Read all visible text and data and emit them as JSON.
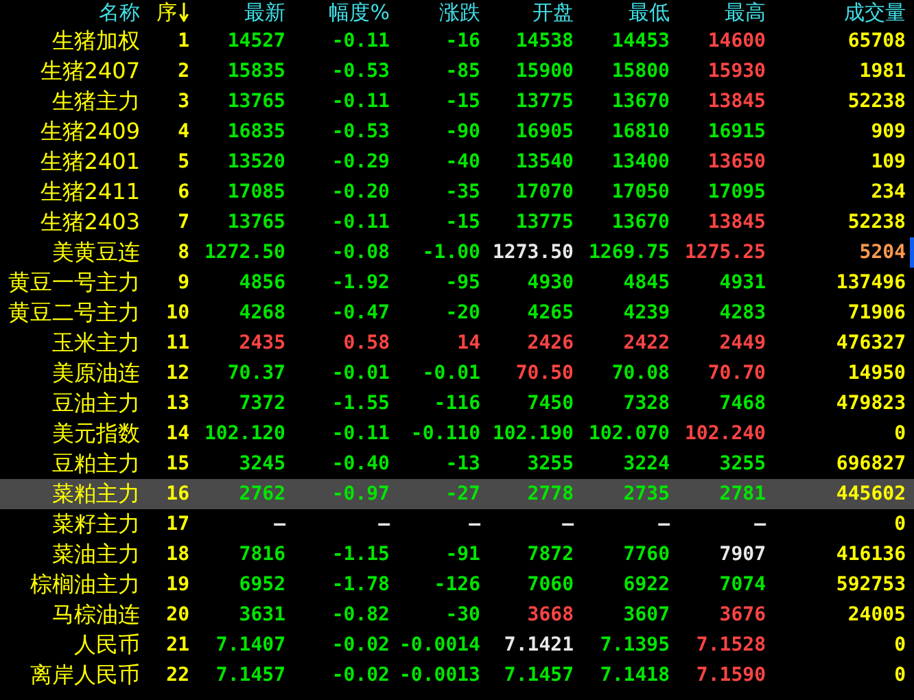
{
  "table": {
    "columns": [
      {
        "label": "名称",
        "sorted": false
      },
      {
        "label": "序",
        "sorted": true
      },
      {
        "label": "最新",
        "sorted": false
      },
      {
        "label": "幅度%",
        "sorted": false
      },
      {
        "label": "涨跌",
        "sorted": false
      },
      {
        "label": "开盘",
        "sorted": false
      },
      {
        "label": "最低",
        "sorted": false
      },
      {
        "label": "最高",
        "sorted": false
      },
      {
        "label": "成交量",
        "sorted": false
      }
    ],
    "rows": [
      {
        "selected": false,
        "marker": false,
        "cells": [
          {
            "text": "生猪加权",
            "color": "#ffff00"
          },
          {
            "text": "1",
            "color": "#ffff00"
          },
          {
            "text": "14527",
            "color": "#00e600"
          },
          {
            "text": "-0.11",
            "color": "#00e600"
          },
          {
            "text": "-16",
            "color": "#00e600"
          },
          {
            "text": "14538",
            "color": "#00e600"
          },
          {
            "text": "14453",
            "color": "#00e600"
          },
          {
            "text": "14600",
            "color": "#ff4444"
          },
          {
            "text": "65708",
            "color": "#ffff00"
          }
        ]
      },
      {
        "selected": false,
        "marker": false,
        "cells": [
          {
            "text": "生猪2407",
            "color": "#ffff00"
          },
          {
            "text": "2",
            "color": "#ffff00"
          },
          {
            "text": "15835",
            "color": "#00e600"
          },
          {
            "text": "-0.53",
            "color": "#00e600"
          },
          {
            "text": "-85",
            "color": "#00e600"
          },
          {
            "text": "15900",
            "color": "#00e600"
          },
          {
            "text": "15800",
            "color": "#00e600"
          },
          {
            "text": "15930",
            "color": "#ff4444"
          },
          {
            "text": "1981",
            "color": "#ffff00"
          }
        ]
      },
      {
        "selected": false,
        "marker": false,
        "cells": [
          {
            "text": "生猪主力",
            "color": "#ffff00"
          },
          {
            "text": "3",
            "color": "#ffff00"
          },
          {
            "text": "13765",
            "color": "#00e600"
          },
          {
            "text": "-0.11",
            "color": "#00e600"
          },
          {
            "text": "-15",
            "color": "#00e600"
          },
          {
            "text": "13775",
            "color": "#00e600"
          },
          {
            "text": "13670",
            "color": "#00e600"
          },
          {
            "text": "13845",
            "color": "#ff4444"
          },
          {
            "text": "52238",
            "color": "#ffff00"
          }
        ]
      },
      {
        "selected": false,
        "marker": false,
        "cells": [
          {
            "text": "生猪2409",
            "color": "#ffff00"
          },
          {
            "text": "4",
            "color": "#ffff00"
          },
          {
            "text": "16835",
            "color": "#00e600"
          },
          {
            "text": "-0.53",
            "color": "#00e600"
          },
          {
            "text": "-90",
            "color": "#00e600"
          },
          {
            "text": "16905",
            "color": "#00e600"
          },
          {
            "text": "16810",
            "color": "#00e600"
          },
          {
            "text": "16915",
            "color": "#00e600"
          },
          {
            "text": "909",
            "color": "#ffff00"
          }
        ]
      },
      {
        "selected": false,
        "marker": false,
        "cells": [
          {
            "text": "生猪2401",
            "color": "#ffff00"
          },
          {
            "text": "5",
            "color": "#ffff00"
          },
          {
            "text": "13520",
            "color": "#00e600"
          },
          {
            "text": "-0.29",
            "color": "#00e600"
          },
          {
            "text": "-40",
            "color": "#00e600"
          },
          {
            "text": "13540",
            "color": "#00e600"
          },
          {
            "text": "13400",
            "color": "#00e600"
          },
          {
            "text": "13650",
            "color": "#ff4444"
          },
          {
            "text": "109",
            "color": "#ffff00"
          }
        ]
      },
      {
        "selected": false,
        "marker": false,
        "cells": [
          {
            "text": "生猪2411",
            "color": "#ffff00"
          },
          {
            "text": "6",
            "color": "#ffff00"
          },
          {
            "text": "17085",
            "color": "#00e600"
          },
          {
            "text": "-0.20",
            "color": "#00e600"
          },
          {
            "text": "-35",
            "color": "#00e600"
          },
          {
            "text": "17070",
            "color": "#00e600"
          },
          {
            "text": "17050",
            "color": "#00e600"
          },
          {
            "text": "17095",
            "color": "#00e600"
          },
          {
            "text": "234",
            "color": "#ffff00"
          }
        ]
      },
      {
        "selected": false,
        "marker": false,
        "cells": [
          {
            "text": "生猪2403",
            "color": "#ffff00"
          },
          {
            "text": "7",
            "color": "#ffff00"
          },
          {
            "text": "13765",
            "color": "#00e600"
          },
          {
            "text": "-0.11",
            "color": "#00e600"
          },
          {
            "text": "-15",
            "color": "#00e600"
          },
          {
            "text": "13775",
            "color": "#00e600"
          },
          {
            "text": "13670",
            "color": "#00e600"
          },
          {
            "text": "13845",
            "color": "#ff4444"
          },
          {
            "text": "52238",
            "color": "#ffff00"
          }
        ]
      },
      {
        "selected": false,
        "marker": true,
        "cells": [
          {
            "text": "美黄豆连",
            "color": "#ffff00"
          },
          {
            "text": "8",
            "color": "#ffff00"
          },
          {
            "text": "1272.50",
            "color": "#00e600"
          },
          {
            "text": "-0.08",
            "color": "#00e600"
          },
          {
            "text": "-1.00",
            "color": "#00e600"
          },
          {
            "text": "1273.50",
            "color": "#e8e8e8"
          },
          {
            "text": "1269.75",
            "color": "#00e600"
          },
          {
            "text": "1275.25",
            "color": "#ff4444"
          },
          {
            "text": "5204",
            "color": "#ff9a50"
          }
        ]
      },
      {
        "selected": false,
        "marker": false,
        "cells": [
          {
            "text": "黄豆一号主力",
            "color": "#ffff00"
          },
          {
            "text": "9",
            "color": "#ffff00"
          },
          {
            "text": "4856",
            "color": "#00e600"
          },
          {
            "text": "-1.92",
            "color": "#00e600"
          },
          {
            "text": "-95",
            "color": "#00e600"
          },
          {
            "text": "4930",
            "color": "#00e600"
          },
          {
            "text": "4845",
            "color": "#00e600"
          },
          {
            "text": "4931",
            "color": "#00e600"
          },
          {
            "text": "137496",
            "color": "#ffff00"
          }
        ]
      },
      {
        "selected": false,
        "marker": false,
        "cells": [
          {
            "text": "黄豆二号主力",
            "color": "#ffff00"
          },
          {
            "text": "10",
            "color": "#ffff00"
          },
          {
            "text": "4268",
            "color": "#00e600"
          },
          {
            "text": "-0.47",
            "color": "#00e600"
          },
          {
            "text": "-20",
            "color": "#00e600"
          },
          {
            "text": "4265",
            "color": "#00e600"
          },
          {
            "text": "4239",
            "color": "#00e600"
          },
          {
            "text": "4283",
            "color": "#00e600"
          },
          {
            "text": "71906",
            "color": "#ffff00"
          }
        ]
      },
      {
        "selected": false,
        "marker": false,
        "cells": [
          {
            "text": "玉米主力",
            "color": "#ffff00"
          },
          {
            "text": "11",
            "color": "#ffff00"
          },
          {
            "text": "2435",
            "color": "#ff4444"
          },
          {
            "text": "0.58",
            "color": "#ff4444"
          },
          {
            "text": "14",
            "color": "#ff4444"
          },
          {
            "text": "2426",
            "color": "#ff4444"
          },
          {
            "text": "2422",
            "color": "#ff4444"
          },
          {
            "text": "2449",
            "color": "#ff4444"
          },
          {
            "text": "476327",
            "color": "#ffff00"
          }
        ]
      },
      {
        "selected": false,
        "marker": false,
        "cells": [
          {
            "text": "美原油连",
            "color": "#ffff00"
          },
          {
            "text": "12",
            "color": "#ffff00"
          },
          {
            "text": "70.37",
            "color": "#00e600"
          },
          {
            "text": "-0.01",
            "color": "#00e600"
          },
          {
            "text": "-0.01",
            "color": "#00e600"
          },
          {
            "text": "70.50",
            "color": "#ff4444"
          },
          {
            "text": "70.08",
            "color": "#00e600"
          },
          {
            "text": "70.70",
            "color": "#ff4444"
          },
          {
            "text": "14950",
            "color": "#ffff00"
          }
        ]
      },
      {
        "selected": false,
        "marker": false,
        "cells": [
          {
            "text": "豆油主力",
            "color": "#ffff00"
          },
          {
            "text": "13",
            "color": "#ffff00"
          },
          {
            "text": "7372",
            "color": "#00e600"
          },
          {
            "text": "-1.55",
            "color": "#00e600"
          },
          {
            "text": "-116",
            "color": "#00e600"
          },
          {
            "text": "7450",
            "color": "#00e600"
          },
          {
            "text": "7328",
            "color": "#00e600"
          },
          {
            "text": "7468",
            "color": "#00e600"
          },
          {
            "text": "479823",
            "color": "#ffff00"
          }
        ]
      },
      {
        "selected": false,
        "marker": false,
        "cells": [
          {
            "text": "美元指数",
            "color": "#ffff00"
          },
          {
            "text": "14",
            "color": "#ffff00"
          },
          {
            "text": "102.120",
            "color": "#00e600"
          },
          {
            "text": "-0.11",
            "color": "#00e600"
          },
          {
            "text": "-0.110",
            "color": "#00e600"
          },
          {
            "text": "102.190",
            "color": "#00e600"
          },
          {
            "text": "102.070",
            "color": "#00e600"
          },
          {
            "text": "102.240",
            "color": "#ff4444"
          },
          {
            "text": "0",
            "color": "#ffff00"
          }
        ]
      },
      {
        "selected": false,
        "marker": false,
        "cells": [
          {
            "text": "豆粕主力",
            "color": "#ffff00"
          },
          {
            "text": "15",
            "color": "#ffff00"
          },
          {
            "text": "3245",
            "color": "#00e600"
          },
          {
            "text": "-0.40",
            "color": "#00e600"
          },
          {
            "text": "-13",
            "color": "#00e600"
          },
          {
            "text": "3255",
            "color": "#00e600"
          },
          {
            "text": "3224",
            "color": "#00e600"
          },
          {
            "text": "3255",
            "color": "#00e600"
          },
          {
            "text": "696827",
            "color": "#ffff00"
          }
        ]
      },
      {
        "selected": true,
        "marker": false,
        "cells": [
          {
            "text": "菜粕主力",
            "color": "#ffff00"
          },
          {
            "text": "16",
            "color": "#ffff00"
          },
          {
            "text": "2762",
            "color": "#00e600"
          },
          {
            "text": "-0.97",
            "color": "#00e600"
          },
          {
            "text": "-27",
            "color": "#00e600"
          },
          {
            "text": "2778",
            "color": "#00e600"
          },
          {
            "text": "2735",
            "color": "#00e600"
          },
          {
            "text": "2781",
            "color": "#00e600"
          },
          {
            "text": "445602",
            "color": "#ffff00"
          }
        ]
      },
      {
        "selected": false,
        "marker": false,
        "cells": [
          {
            "text": "菜籽主力",
            "color": "#ffff00"
          },
          {
            "text": "17",
            "color": "#ffff00"
          },
          {
            "text": "—",
            "color": "#e8e8e8"
          },
          {
            "text": "—",
            "color": "#e8e8e8"
          },
          {
            "text": "—",
            "color": "#e8e8e8"
          },
          {
            "text": "—",
            "color": "#e8e8e8"
          },
          {
            "text": "—",
            "color": "#e8e8e8"
          },
          {
            "text": "—",
            "color": "#e8e8e8"
          },
          {
            "text": "0",
            "color": "#ffff00"
          }
        ]
      },
      {
        "selected": false,
        "marker": false,
        "cells": [
          {
            "text": "菜油主力",
            "color": "#ffff00"
          },
          {
            "text": "18",
            "color": "#ffff00"
          },
          {
            "text": "7816",
            "color": "#00e600"
          },
          {
            "text": "-1.15",
            "color": "#00e600"
          },
          {
            "text": "-91",
            "color": "#00e600"
          },
          {
            "text": "7872",
            "color": "#00e600"
          },
          {
            "text": "7760",
            "color": "#00e600"
          },
          {
            "text": "7907",
            "color": "#e8e8e8"
          },
          {
            "text": "416136",
            "color": "#ffff00"
          }
        ]
      },
      {
        "selected": false,
        "marker": false,
        "cells": [
          {
            "text": "棕榈油主力",
            "color": "#ffff00"
          },
          {
            "text": "19",
            "color": "#ffff00"
          },
          {
            "text": "6952",
            "color": "#00e600"
          },
          {
            "text": "-1.78",
            "color": "#00e600"
          },
          {
            "text": "-126",
            "color": "#00e600"
          },
          {
            "text": "7060",
            "color": "#00e600"
          },
          {
            "text": "6922",
            "color": "#00e600"
          },
          {
            "text": "7074",
            "color": "#00e600"
          },
          {
            "text": "592753",
            "color": "#ffff00"
          }
        ]
      },
      {
        "selected": false,
        "marker": false,
        "cells": [
          {
            "text": "马棕油连",
            "color": "#ffff00"
          },
          {
            "text": "20",
            "color": "#ffff00"
          },
          {
            "text": "3631",
            "color": "#00e600"
          },
          {
            "text": "-0.82",
            "color": "#00e600"
          },
          {
            "text": "-30",
            "color": "#00e600"
          },
          {
            "text": "3668",
            "color": "#ff4444"
          },
          {
            "text": "3607",
            "color": "#00e600"
          },
          {
            "text": "3676",
            "color": "#ff4444"
          },
          {
            "text": "24005",
            "color": "#ffff00"
          }
        ]
      },
      {
        "selected": false,
        "marker": false,
        "cells": [
          {
            "text": "人民币",
            "color": "#ffff00"
          },
          {
            "text": "21",
            "color": "#ffff00"
          },
          {
            "text": "7.1407",
            "color": "#00e600"
          },
          {
            "text": "-0.02",
            "color": "#00e600"
          },
          {
            "text": "-0.0014",
            "color": "#00e600"
          },
          {
            "text": "7.1421",
            "color": "#e8e8e8"
          },
          {
            "text": "7.1395",
            "color": "#00e600"
          },
          {
            "text": "7.1528",
            "color": "#ff4444"
          },
          {
            "text": "0",
            "color": "#ffff00"
          }
        ]
      },
      {
        "selected": false,
        "marker": false,
        "cells": [
          {
            "text": "离岸人民币",
            "color": "#ffff00"
          },
          {
            "text": "22",
            "color": "#ffff00"
          },
          {
            "text": "7.1457",
            "color": "#00e600"
          },
          {
            "text": "-0.02",
            "color": "#00e600"
          },
          {
            "text": "-0.0013",
            "color": "#00e600"
          },
          {
            "text": "7.1457",
            "color": "#00e600"
          },
          {
            "text": "7.1418",
            "color": "#00e600"
          },
          {
            "text": "7.1590",
            "color": "#ff4444"
          },
          {
            "text": "0",
            "color": "#ffff00"
          }
        ]
      }
    ]
  }
}
